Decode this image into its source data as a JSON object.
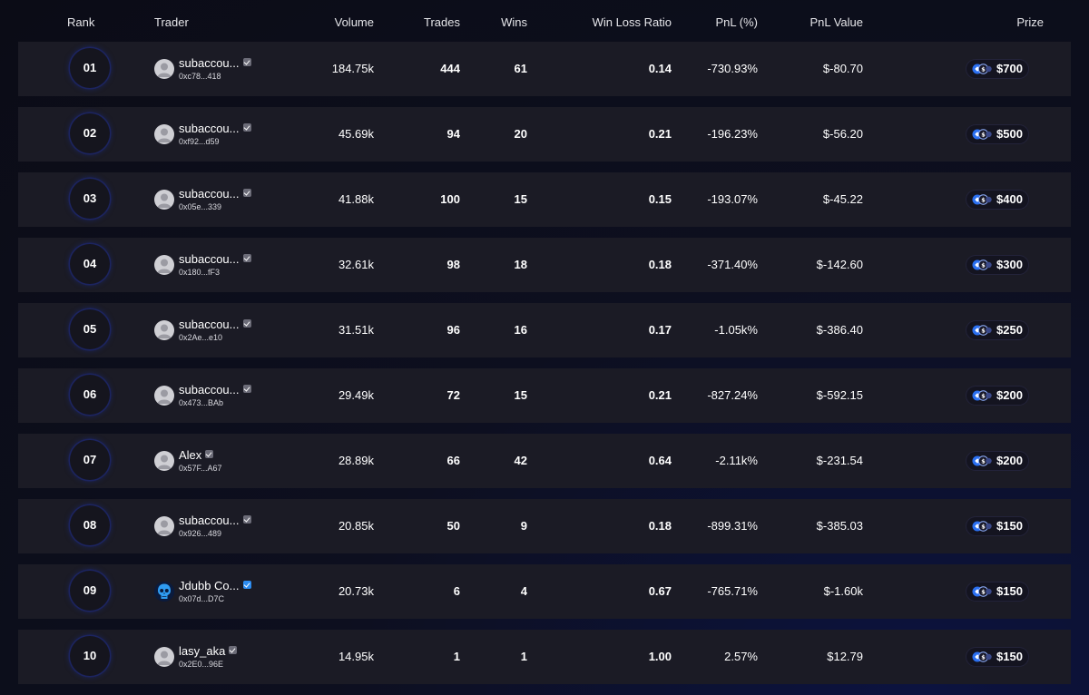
{
  "header": {
    "rank": "Rank",
    "trader": "Trader",
    "volume": "Volume",
    "trades": "Trades",
    "wins": "Wins",
    "win_loss_ratio": "Win Loss Ratio",
    "pnl_pct": "PnL (%)",
    "pnl_value": "PnL Value",
    "prize": "Prize"
  },
  "rows": [
    {
      "rank": "01",
      "name": "subaccou...",
      "address": "0xc78...418",
      "verified": "gray",
      "avatar": "default",
      "volume": "184.75k",
      "trades": "444",
      "wins": "61",
      "ratio": "0.14",
      "pnl_pct": "-730.93%",
      "pnl_value": "$-80.70",
      "prize": "$700"
    },
    {
      "rank": "02",
      "name": "subaccou...",
      "address": "0xf92...d59",
      "verified": "gray",
      "avatar": "default",
      "volume": "45.69k",
      "trades": "94",
      "wins": "20",
      "ratio": "0.21",
      "pnl_pct": "-196.23%",
      "pnl_value": "$-56.20",
      "prize": "$500"
    },
    {
      "rank": "03",
      "name": "subaccou...",
      "address": "0x05e...339",
      "verified": "gray",
      "avatar": "default",
      "volume": "41.88k",
      "trades": "100",
      "wins": "15",
      "ratio": "0.15",
      "pnl_pct": "-193.07%",
      "pnl_value": "$-45.22",
      "prize": "$400"
    },
    {
      "rank": "04",
      "name": "subaccou...",
      "address": "0x180...fF3",
      "verified": "gray",
      "avatar": "default",
      "volume": "32.61k",
      "trades": "98",
      "wins": "18",
      "ratio": "0.18",
      "pnl_pct": "-371.40%",
      "pnl_value": "$-142.60",
      "prize": "$300"
    },
    {
      "rank": "05",
      "name": "subaccou...",
      "address": "0x2Ae...e10",
      "verified": "gray",
      "avatar": "default",
      "volume": "31.51k",
      "trades": "96",
      "wins": "16",
      "ratio": "0.17",
      "pnl_pct": "-1.05k%",
      "pnl_value": "$-386.40",
      "prize": "$250"
    },
    {
      "rank": "06",
      "name": "subaccou...",
      "address": "0x473...BAb",
      "verified": "gray",
      "avatar": "default",
      "volume": "29.49k",
      "trades": "72",
      "wins": "15",
      "ratio": "0.21",
      "pnl_pct": "-827.24%",
      "pnl_value": "$-592.15",
      "prize": "$200"
    },
    {
      "rank": "07",
      "name": "Alex",
      "address": "0x57F...A67",
      "verified": "gray",
      "avatar": "default",
      "volume": "28.89k",
      "trades": "66",
      "wins": "42",
      "ratio": "0.64",
      "pnl_pct": "-2.11k%",
      "pnl_value": "$-231.54",
      "prize": "$200"
    },
    {
      "rank": "08",
      "name": "subaccou...",
      "address": "0x926...489",
      "verified": "gray",
      "avatar": "default",
      "volume": "20.85k",
      "trades": "50",
      "wins": "9",
      "ratio": "0.18",
      "pnl_pct": "-899.31%",
      "pnl_value": "$-385.03",
      "prize": "$150"
    },
    {
      "rank": "09",
      "name": "Jdubb Co...",
      "address": "0x07d...D7C",
      "verified": "blue",
      "avatar": "skull",
      "volume": "20.73k",
      "trades": "6",
      "wins": "4",
      "ratio": "0.67",
      "pnl_pct": "-765.71%",
      "pnl_value": "$-1.60k",
      "prize": "$150"
    },
    {
      "rank": "10",
      "name": "lasy_aka",
      "address": "0x2E0...96E",
      "verified": "gray",
      "avatar": "default",
      "volume": "14.95k",
      "trades": "1",
      "wins": "1",
      "ratio": "1.00",
      "pnl_pct": "2.57%",
      "pnl_value": "$12.79",
      "prize": "$150"
    }
  ],
  "icons": {
    "avatar_default": "user-avatar-icon",
    "avatar_skull": "skull-avatar-icon",
    "verified": "verified-badge-icon",
    "prize_coin": "prize-token-icon"
  },
  "colors": {
    "background": "#0d0f1f",
    "row_background": "#1b1b25",
    "rank_ring": "#1c2460",
    "verified_gray": "#6c6c78",
    "verified_blue": "#2b8bf0",
    "coin_blue": "#2a6ff0"
  }
}
